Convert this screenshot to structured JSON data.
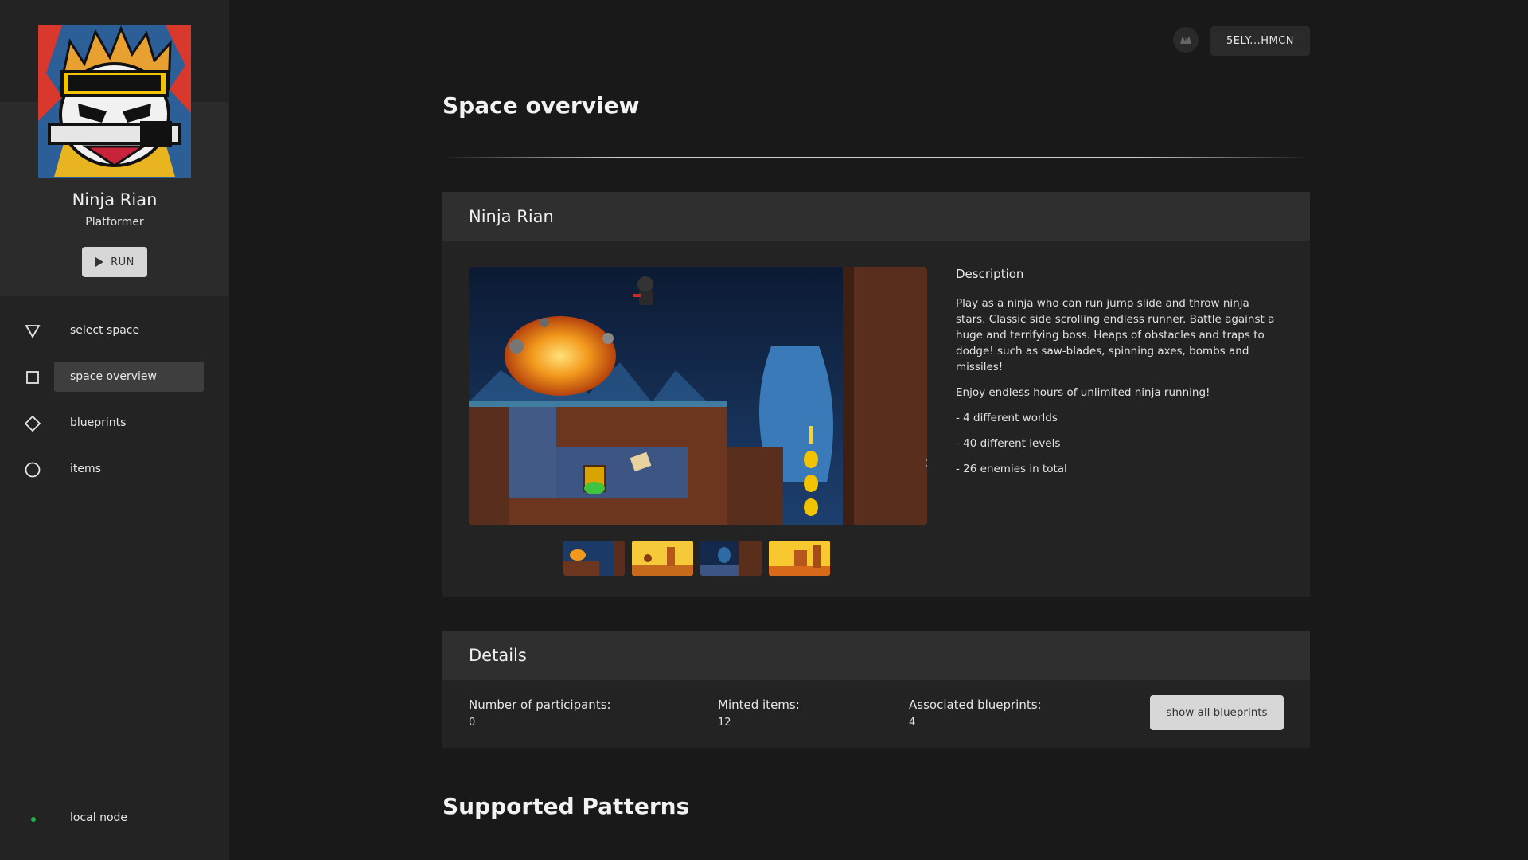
{
  "sidebar": {
    "space": {
      "name": "Ninja Rian",
      "genre": "Platformer",
      "avatar_icon": "ninja-avatar"
    },
    "run_button": {
      "label": "RUN",
      "icon": "play-icon"
    },
    "nav": [
      {
        "label": "select space",
        "icon": "triangle-icon",
        "active": false
      },
      {
        "label": "space overview",
        "icon": "square-icon",
        "active": true
      },
      {
        "label": "blueprints",
        "icon": "diamond-icon",
        "active": false
      },
      {
        "label": "items",
        "icon": "circle-icon",
        "active": false
      }
    ],
    "node": {
      "label": "local node",
      "status_color": "#22b34c"
    }
  },
  "header": {
    "account_label": "5ELY...HMCN",
    "account_icon": "user-avatar-icon"
  },
  "main": {
    "title": "Space overview",
    "overview": {
      "heading": "Ninja Rian",
      "description_title": "Description",
      "description": [
        "Play as a ninja who can run jump slide and throw ninja stars. Classic side scrolling endless runner. Battle against a huge and terrifying boss. Heaps of obstacles and traps to dodge! such as saw-blades, spinning axes, bombs and missiles!",
        "Enjoy endless hours of unlimited ninja running!",
        "- 4 different worlds",
        "- 40 different levels",
        "- 26 enemies in total"
      ],
      "next_icon": "chevron-right-icon",
      "thumbnail_count": 4
    },
    "details": {
      "heading": "Details",
      "participants_label": "Number of participants:",
      "participants_value": "0",
      "minted_label": "Minted items:",
      "minted_value": "12",
      "blueprints_label": "Associated blueprints:",
      "blueprints_value": "4",
      "show_blueprints_label": "show all blueprints"
    },
    "supported_patterns_title": "Supported Patterns"
  },
  "colors": {
    "background": "#191919",
    "sidebar": "#232323",
    "panel": "#232323",
    "panel_header": "#2f2f2f",
    "button": "#d7d7d7",
    "node_online": "#22b34c"
  }
}
